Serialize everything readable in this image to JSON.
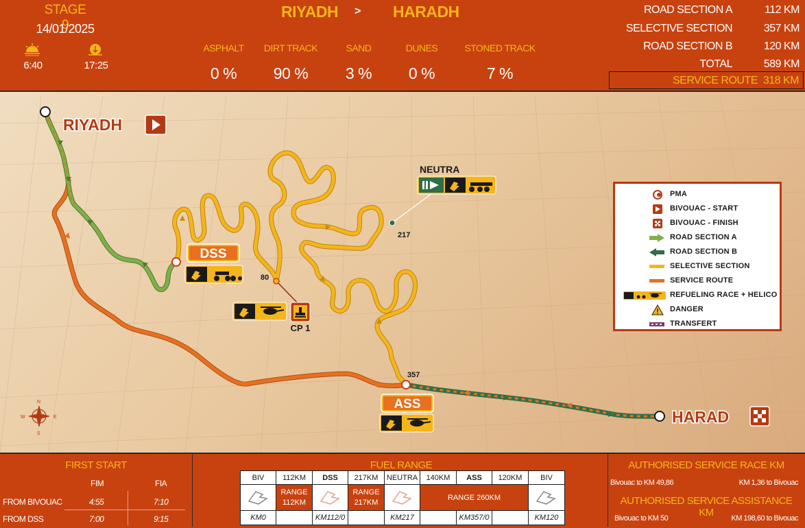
{
  "header": {
    "stage": "STAGE 9",
    "date": "14/01/2025",
    "sunrise": "6:40",
    "sunset": "17:25",
    "from": "RIYADH",
    "separator": ">",
    "to": "HARADH"
  },
  "surfaces": [
    {
      "label": "ASPHALT",
      "value": "0 %"
    },
    {
      "label": "DIRT TRACK",
      "value": "90 %"
    },
    {
      "label": "SAND",
      "value": "3 %"
    },
    {
      "label": "DUNES",
      "value": "0 %"
    },
    {
      "label": "STONED TRACK",
      "value": "7 %"
    }
  ],
  "distances": [
    {
      "label": "ROAD SECTION A",
      "value": "112 KM"
    },
    {
      "label": "SELECTIVE SECTION",
      "value": "357 KM"
    },
    {
      "label": "ROAD SECTION B",
      "value": "120 KM"
    },
    {
      "label": "TOTAL",
      "value": "589 KM"
    },
    {
      "label": "SERVICE ROUTE",
      "value": "318 KM"
    }
  ],
  "map": {
    "start_city": "RIYADH",
    "finish_city": "HARAD",
    "dss_label": "DSS",
    "ass_label": "ASS",
    "cp_label": "CP 1",
    "neutra_label": "NEUTRA",
    "km_80": "80",
    "km_217": "217",
    "km_357": "357",
    "compass": {
      "n": "N",
      "s": "S",
      "e": "E",
      "w": "W"
    }
  },
  "legend": [
    {
      "icon": "pma-icon",
      "label": "PMA"
    },
    {
      "icon": "bivouac-start-icon",
      "label": "BIVOUAC - START"
    },
    {
      "icon": "bivouac-finish-icon",
      "label": "BIVOUAC - FINISH"
    },
    {
      "icon": "road-section-a-icon",
      "label": "ROAD SECTION A"
    },
    {
      "icon": "road-section-b-icon",
      "label": "ROAD SECTION B"
    },
    {
      "icon": "selective-section-icon",
      "label": "SELECTIVE SECTION"
    },
    {
      "icon": "service-route-icon",
      "label": "SERVICE ROUTE"
    },
    {
      "icon": "refueling-icon",
      "label": "REFUELING RACE + HELICO"
    },
    {
      "icon": "danger-icon",
      "label": "DANGER"
    },
    {
      "icon": "transfert-icon",
      "label": "TRANSFERT"
    }
  ],
  "first_start": {
    "title": "FIRST START",
    "columns": [
      "FIM",
      "FIA"
    ],
    "rows": [
      {
        "label": "FROM BIVOUAC",
        "fim": "4:55",
        "fia": "7:10"
      },
      {
        "label": "FROM DSS",
        "fim": "7:00",
        "fia": "9:15"
      }
    ]
  },
  "fuel_range": {
    "title": "FUEL RANGE",
    "headers": [
      "BIV",
      "112KM",
      "DSS",
      "217KM",
      "NEUTRA",
      "140KM",
      "ASS",
      "120KM",
      "BIV"
    ],
    "ranges": [
      "RANGE 112KM",
      "RANGE 217KM",
      "RANGE 260KM"
    ],
    "km": [
      "KM0",
      "KM112/0",
      "KM217",
      "KM357/0",
      "KM120"
    ]
  },
  "authorised": {
    "race_title": "AUTHORISED SERVICE RACE KM",
    "race_left": "Bivouac to KM 49,86",
    "race_right": "KM 1,36 to Bivouac",
    "assist_title": "AUTHORISED SERVICE ASSISTANCE KM",
    "assist_left": "Bivouac to KM 50",
    "assist_right": "KM 198,60 to Bivouac"
  },
  "colors": {
    "brand": "#c8420f",
    "accent": "#f5b51b",
    "selective": "#f5b51b",
    "service": "#e8701e",
    "road_a": "#6a9e3f",
    "road_b": "#2f6e48"
  }
}
